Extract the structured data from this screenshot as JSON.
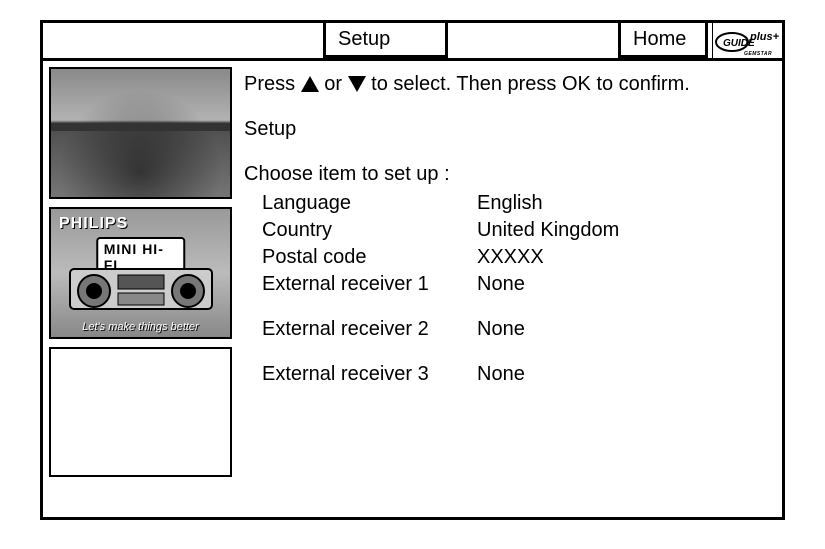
{
  "header": {
    "tab_setup": "Setup",
    "tab_home": "Home",
    "logo_text": "GUIDE plus+",
    "logo_sub": "GEMSTAR"
  },
  "sidebar": {
    "ad_brand": "PHILIPS",
    "ad_product": "MINI HI-FI",
    "ad_tagline": "Let's make things better"
  },
  "main": {
    "instruction_pre": "Press ",
    "instruction_mid": " or ",
    "instruction_post": " to select. Then press OK to confirm.",
    "section": "Setup",
    "prompt": "Choose item to set up :",
    "items": [
      {
        "label": "Language",
        "value": "English"
      },
      {
        "label": "Country",
        "value": "United Kingdom"
      },
      {
        "label": "Postal code",
        "value": "XXXXX"
      },
      {
        "label": "External receiver 1",
        "value": "None"
      },
      {
        "label": "External receiver 2",
        "value": "None"
      },
      {
        "label": "External receiver 3",
        "value": "None"
      }
    ]
  }
}
